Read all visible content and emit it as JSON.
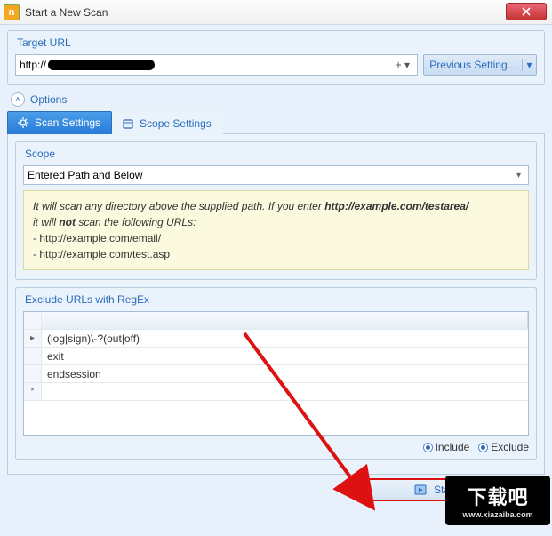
{
  "window": {
    "title": "Start a New Scan"
  },
  "target": {
    "group_title": "Target URL",
    "url_prefix": "http://",
    "previous_label": "Previous Setting..."
  },
  "options": {
    "label": "Options"
  },
  "tabs": {
    "scan": "Scan Settings",
    "scope": "Scope Settings"
  },
  "scope": {
    "group_title": "Scope",
    "selected": "Entered Path and Below",
    "info": {
      "line1_a": "It will scan any directory above the supplied path. If you enter ",
      "line1_b": "http://example.com/testarea/",
      "line2_a": "it will ",
      "line2_b": "not",
      "line2_c": " scan the following URLs:",
      "bullet1": " - http://example.com/email/",
      "bullet2": " - http://example.com/test.asp"
    }
  },
  "exclude": {
    "group_title": "Exclude URLs with RegEx",
    "rows": [
      "(log|sign)\\-?(out|off)",
      "exit",
      "endsession"
    ],
    "radio_include": "Include",
    "radio_exclude": "Exclude"
  },
  "start": {
    "label": "Start Scan"
  },
  "watermark": {
    "big": "下载吧",
    "small": "www.xiazaiba.com"
  }
}
